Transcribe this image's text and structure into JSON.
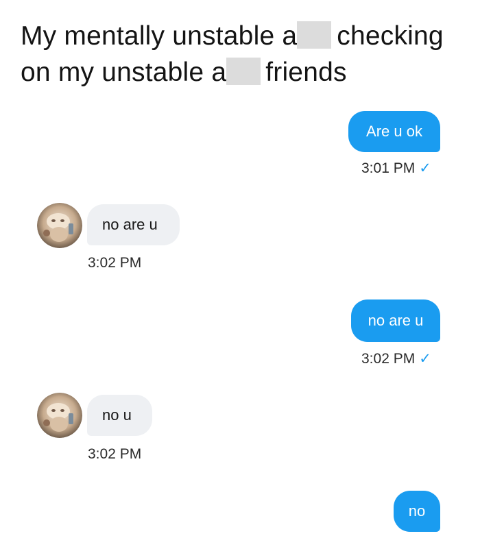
{
  "caption": {
    "line1_a": "My mentally unstable a",
    "line1_b": "checking",
    "line2_a": "on my unstable a",
    "line2_b": "friends"
  },
  "messages": [
    {
      "direction": "outgoing",
      "text": "Are u ok",
      "time": "3:01 PM",
      "status": "sent-check"
    },
    {
      "direction": "incoming",
      "text": "no are u",
      "time": "3:02 PM",
      "avatar": "contact-avatar"
    },
    {
      "direction": "outgoing",
      "text": "no are u",
      "time": "3:02 PM",
      "status": "sent-check"
    },
    {
      "direction": "incoming",
      "text": "no u",
      "time": "3:02 PM",
      "avatar": "contact-avatar"
    },
    {
      "direction": "outgoing",
      "text": "no"
    }
  ],
  "icons": {
    "check": "✓"
  },
  "colors": {
    "outgoing_bubble": "#1a9cf0",
    "incoming_bubble": "#eef0f3",
    "check": "#1a9cf0",
    "censor_box": "#dcdcdc"
  }
}
